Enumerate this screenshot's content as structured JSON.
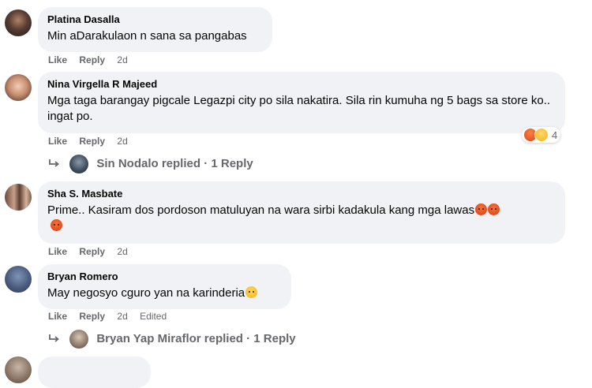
{
  "comments": [
    {
      "author": "Platina Dasalla",
      "text": "Min aDarakulaon n sana sa pangabas",
      "actions": {
        "like": "Like",
        "reply": "Reply",
        "time": "2d"
      }
    },
    {
      "author": "Nina Virgella R Majeed",
      "text": "Mga taga barangay pigcale Legazpi city po sila nakatira. Sila rin kumuha ng 5 bags sa store ko.. ingat po.",
      "actions": {
        "like": "Like",
        "reply": "Reply",
        "time": "2d"
      },
      "reactions": {
        "icons": [
          "angry",
          "sad"
        ],
        "count": "4"
      },
      "replies_text": "Sin Nodalo replied · 1 Reply"
    },
    {
      "author": "Sha S. Masbate",
      "text": "Prime.. Kasiram dos pordoson matuluyan na wara sirbi kadakula kang mga lawas",
      "emojis": [
        "angry-face",
        "angry-face",
        "angry-face"
      ],
      "actions": {
        "like": "Like",
        "reply": "Reply",
        "time": "2d"
      }
    },
    {
      "author": "Bryan Romero",
      "text": "May negosyo cguro yan na karinderia",
      "emojis": [
        "rolling-laughing-face"
      ],
      "actions": {
        "like": "Like",
        "reply": "Reply",
        "time": "2d",
        "edited": "Edited"
      },
      "replies_text": "Bryan Yap Miraflor replied · 1 Reply"
    }
  ],
  "colors": {
    "bubble": "#f0f2f5",
    "meta": "#65676b",
    "text": "#050505"
  }
}
